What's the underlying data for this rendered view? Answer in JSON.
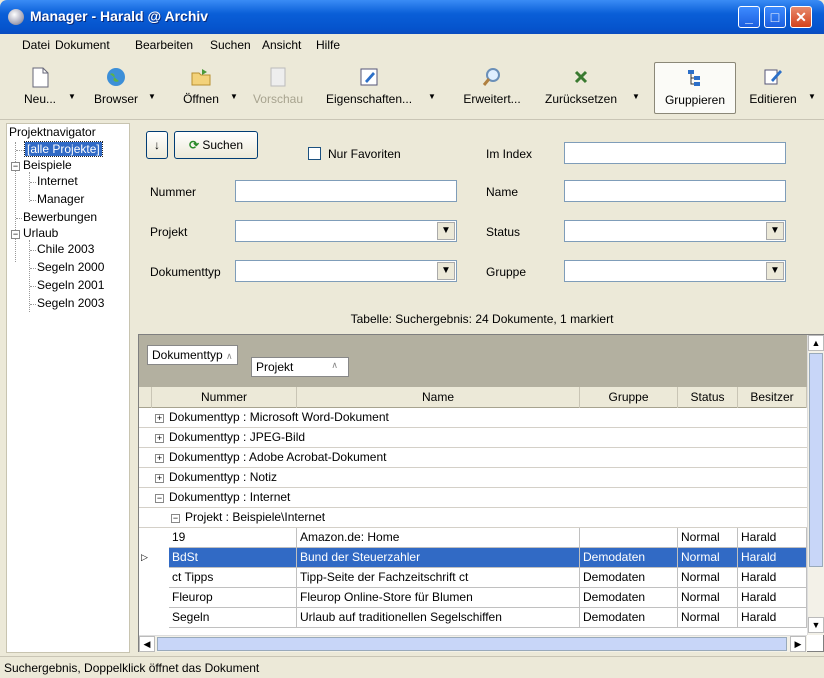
{
  "window": {
    "title": "Manager - Harald @ Archiv"
  },
  "menu": [
    "Datei",
    "Dokument",
    "Bearbeiten",
    "Suchen",
    "Ansicht",
    "Hilfe"
  ],
  "toolbar": {
    "neu": "Neu...",
    "browser": "Browser",
    "oeffnen": "Öffnen",
    "vorschau": "Vorschau",
    "eigenschaften": "Eigenschaften...",
    "erweitert": "Erweitert...",
    "zuruecksetzen": "Zurücksetzen",
    "gruppieren": "Gruppieren",
    "editieren": "Editieren"
  },
  "nav": {
    "title": "Projektnavigator",
    "items": [
      "[alle Projekte]",
      "Beispiele",
      "Internet",
      "Manager",
      "Bewerbungen",
      "Urlaub",
      "Chile 2003",
      "Segeln 2000",
      "Segeln 2001",
      "Segeln 2003"
    ]
  },
  "search": {
    "button": "Suchen",
    "favorites": "Nur Favoriten",
    "imindex": "Im Index",
    "nummer": "Nummer",
    "name": "Name",
    "projekt": "Projekt",
    "status": "Status",
    "dokumenttyp": "Dokumenttyp",
    "gruppe": "Gruppe"
  },
  "result_caption": "Tabelle: Suchergebnis: 24 Dokumente, 1 markiert",
  "grid": {
    "group_chips": [
      "Dokumenttyp",
      "Projekt"
    ],
    "headers": [
      "Nummer",
      "Name",
      "Gruppe",
      "Status",
      "Besitzer"
    ],
    "groups": [
      "Dokumenttyp : Microsoft Word-Dokument",
      "Dokumenttyp : JPEG-Bild",
      "Dokumenttyp : Adobe Acrobat-Dokument",
      "Dokumenttyp : Notiz",
      "Dokumenttyp : Internet"
    ],
    "subgroup": "Projekt : Beispiele\\Internet",
    "rows": [
      [
        "19",
        "Amazon.de: Home",
        "",
        "Normal",
        "Harald"
      ],
      [
        "BdSt",
        "Bund der Steuerzahler",
        "Demodaten",
        "Normal",
        "Harald"
      ],
      [
        "ct Tipps",
        "Tipp-Seite der Fachzeitschrift ct",
        "Demodaten",
        "Normal",
        "Harald"
      ],
      [
        "Fleurop",
        "Fleurop Online-Store für Blumen",
        "Demodaten",
        "Normal",
        "Harald"
      ],
      [
        "Segeln",
        "Urlaub auf traditionellen Segelschiffen",
        "Demodaten",
        "Normal",
        "Harald"
      ]
    ]
  },
  "status": "Suchergebnis, Doppelklick öffnet das Dokument"
}
